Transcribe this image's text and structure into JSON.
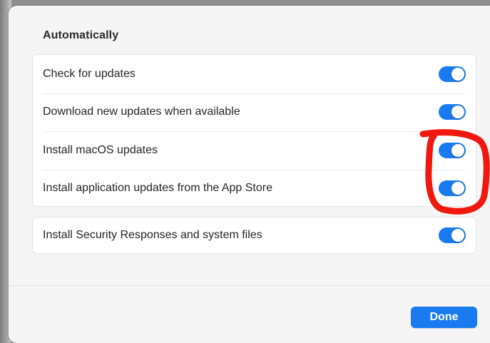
{
  "sheet": {
    "section_title": "Automatically",
    "main_group": [
      {
        "label": "Check for updates",
        "on": true
      },
      {
        "label": "Download new updates when available",
        "on": true
      },
      {
        "label": "Install macOS updates",
        "on": true
      },
      {
        "label": "Install application updates from the App Store",
        "on": true
      }
    ],
    "security_group": [
      {
        "label": "Install Security Responses and system files",
        "on": true
      }
    ],
    "done_label": "Done"
  },
  "colors": {
    "accent": "#1a7bf1",
    "annotation": "#f0180f"
  },
  "icons": [
    "toggle-switch-on"
  ],
  "annotation": "red-circle-around-toggles-3-4"
}
